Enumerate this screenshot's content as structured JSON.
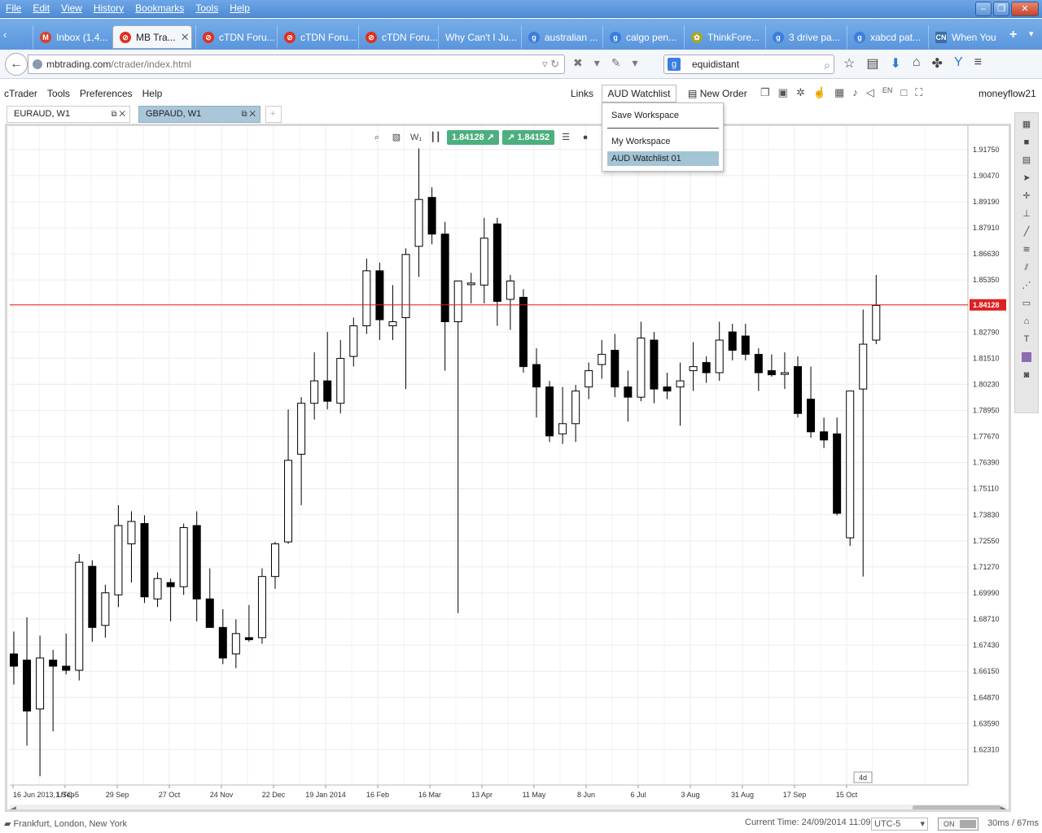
{
  "browser": {
    "menu": [
      "File",
      "Edit",
      "View",
      "History",
      "Bookmarks",
      "Tools",
      "Help"
    ],
    "tabs": [
      {
        "label": "Inbox (1,4...",
        "icon": "gmail-icon",
        "color": "#d9402f"
      },
      {
        "label": "MB Tra...",
        "icon": "mb-icon",
        "color": "#e0301e",
        "active": true
      },
      {
        "label": "cTDN Foru...",
        "icon": "ctdn-icon",
        "color": "#e0301e"
      },
      {
        "label": "cTDN Foru...",
        "icon": "ctdn-icon",
        "color": "#e0301e"
      },
      {
        "label": "cTDN Foru...",
        "icon": "ctdn-icon",
        "color": "#e0301e"
      },
      {
        "label": "Why Can't I Ju...",
        "icon": "",
        "color": ""
      },
      {
        "label": "australian ...",
        "icon": "google-icon",
        "color": "#3b7de0"
      },
      {
        "label": "calgo pen...",
        "icon": "google-icon",
        "color": "#3b7de0"
      },
      {
        "label": "ThinkFore...",
        "icon": "thinkforex-icon",
        "color": "#a6a62a"
      },
      {
        "label": "3 drive pa...",
        "icon": "google-icon",
        "color": "#3b7de0"
      },
      {
        "label": "xabcd pat...",
        "icon": "google-icon",
        "color": "#3b7de0"
      },
      {
        "label": "When You",
        "icon": "cn-icon",
        "color": "#3a6ea5"
      }
    ],
    "url_domain": "mbtrading.com",
    "url_path": "/ctrader/index.html",
    "search_value": "equidistant"
  },
  "app": {
    "menu": [
      "cTrader",
      "Tools",
      "Preferences",
      "Help"
    ],
    "links": "Links",
    "watchlist": "AUD Watchlist 01",
    "new_order": "New Order",
    "user": "moneyflow21",
    "chart_tabs": [
      "EURAUD, W1",
      "GBPAUD, W1"
    ],
    "bid": "1.84128",
    "ask": "1.84152",
    "dropdown": {
      "save": "Save Workspace",
      "my": "My Workspace",
      "selected": "AUD Watchlist 01"
    },
    "status": {
      "markets": "Frankfurt, London, New York",
      "time": "Current Time: 24/09/2014 11:09",
      "tz": "UTC-5",
      "toggle": "ON",
      "latency": "30ms / 67ms",
      "badge": "4d"
    }
  },
  "chart_data": {
    "type": "candlestick",
    "symbol": "GBPAUD",
    "timeframe": "W1",
    "current_price": 1.84128,
    "price_line_color": "#e02020",
    "ylim": [
      1.6057,
      1.929
    ],
    "yticks": [
      "1.91750",
      "1.90470",
      "1.89190",
      "1.87910",
      "1.86630",
      "1.85350",
      "1.84070",
      "1.82790",
      "1.81510",
      "1.80230",
      "1.78950",
      "1.77670",
      "1.76390",
      "1.75110",
      "1.73830",
      "1.72550",
      "1.71270",
      "1.69990",
      "1.68710",
      "1.67430",
      "1.66150",
      "1.64870",
      "1.63590",
      "1.62310"
    ],
    "xticks": [
      "16 Jun 2013, UTC-5",
      "1 Sep",
      "29 Sep",
      "27 Oct",
      "24 Nov",
      "22 Dec",
      "19 Jan 2014",
      "16 Feb",
      "16 Mar",
      "13 Apr",
      "11 May",
      "8 Jun",
      "6 Jul",
      "3 Aug",
      "31 Aug",
      "17 Sep",
      "15 Oct"
    ],
    "candles": [
      [
        1.67,
        1.681,
        1.655,
        1.664
      ],
      [
        1.667,
        1.688,
        1.625,
        1.642
      ],
      [
        1.643,
        1.679,
        1.61,
        1.668
      ],
      [
        1.667,
        1.672,
        1.632,
        1.664
      ],
      [
        1.664,
        1.68,
        1.66,
        1.662
      ],
      [
        1.662,
        1.719,
        1.657,
        1.715
      ],
      [
        1.713,
        1.716,
        1.676,
        1.683
      ],
      [
        1.684,
        1.704,
        1.678,
        1.7
      ],
      [
        1.699,
        1.743,
        1.693,
        1.733
      ],
      [
        1.724,
        1.74,
        1.705,
        1.735
      ],
      [
        1.734,
        1.738,
        1.695,
        1.698
      ],
      [
        1.697,
        1.71,
        1.693,
        1.707
      ],
      [
        1.705,
        1.707,
        1.686,
        1.703
      ],
      [
        1.703,
        1.734,
        1.699,
        1.732
      ],
      [
        1.733,
        1.74,
        1.686,
        1.697
      ],
      [
        1.697,
        1.712,
        1.684,
        1.683
      ],
      [
        1.683,
        1.692,
        1.665,
        1.668
      ],
      [
        1.67,
        1.687,
        1.663,
        1.68
      ],
      [
        1.678,
        1.694,
        1.676,
        1.677
      ],
      [
        1.678,
        1.712,
        1.675,
        1.708
      ],
      [
        1.708,
        1.725,
        1.702,
        1.724
      ],
      [
        1.725,
        1.79,
        1.724,
        1.765
      ],
      [
        1.768,
        1.796,
        1.743,
        1.793
      ],
      [
        1.793,
        1.818,
        1.785,
        1.804
      ],
      [
        1.804,
        1.828,
        1.79,
        1.794
      ],
      [
        1.793,
        1.824,
        1.788,
        1.815
      ],
      [
        1.816,
        1.835,
        1.811,
        1.831
      ],
      [
        1.831,
        1.864,
        1.827,
        1.858
      ],
      [
        1.858,
        1.862,
        1.824,
        1.834
      ],
      [
        1.831,
        1.851,
        1.824,
        1.833
      ],
      [
        1.835,
        1.869,
        1.8,
        1.866
      ],
      [
        1.87,
        1.918,
        1.855,
        1.893
      ],
      [
        1.894,
        1.899,
        1.871,
        1.876
      ],
      [
        1.876,
        1.882,
        1.809,
        1.833
      ],
      [
        1.833,
        1.847,
        1.69,
        1.853
      ],
      [
        1.852,
        1.857,
        1.842,
        1.852
      ],
      [
        1.851,
        1.884,
        1.842,
        1.874
      ],
      [
        1.881,
        1.884,
        1.831,
        1.843
      ],
      [
        1.844,
        1.856,
        1.829,
        1.853
      ],
      [
        1.845,
        1.849,
        1.808,
        1.811
      ],
      [
        1.812,
        1.82,
        1.786,
        1.801
      ],
      [
        1.801,
        1.804,
        1.774,
        1.777
      ],
      [
        1.778,
        1.801,
        1.773,
        1.783
      ],
      [
        1.783,
        1.802,
        1.774,
        1.799
      ],
      [
        1.801,
        1.813,
        1.795,
        1.809
      ],
      [
        1.812,
        1.824,
        1.805,
        1.817
      ],
      [
        1.819,
        1.827,
        1.796,
        1.801
      ],
      [
        1.801,
        1.809,
        1.784,
        1.796
      ],
      [
        1.796,
        1.833,
        1.794,
        1.825
      ],
      [
        1.824,
        1.828,
        1.793,
        1.8
      ],
      [
        1.801,
        1.808,
        1.795,
        1.799
      ],
      [
        1.801,
        1.813,
        1.782,
        1.804
      ],
      [
        1.809,
        1.823,
        1.799,
        1.811
      ],
      [
        1.813,
        1.816,
        1.803,
        1.808
      ],
      [
        1.808,
        1.833,
        1.804,
        1.824
      ],
      [
        1.828,
        1.832,
        1.814,
        1.819
      ],
      [
        1.826,
        1.832,
        1.814,
        1.817
      ],
      [
        1.817,
        1.82,
        1.799,
        1.808
      ],
      [
        1.809,
        1.817,
        1.806,
        1.807
      ],
      [
        1.808,
        1.818,
        1.8,
        1.808
      ],
      [
        1.811,
        1.816,
        1.786,
        1.788
      ],
      [
        1.795,
        1.811,
        1.776,
        1.779
      ],
      [
        1.779,
        1.786,
        1.771,
        1.775
      ],
      [
        1.778,
        1.786,
        1.738,
        1.739
      ],
      [
        1.727,
        1.786,
        1.723,
        1.799
      ],
      [
        1.8,
        1.839,
        1.708,
        1.822
      ],
      [
        1.824,
        1.856,
        1.822,
        1.841
      ]
    ]
  }
}
